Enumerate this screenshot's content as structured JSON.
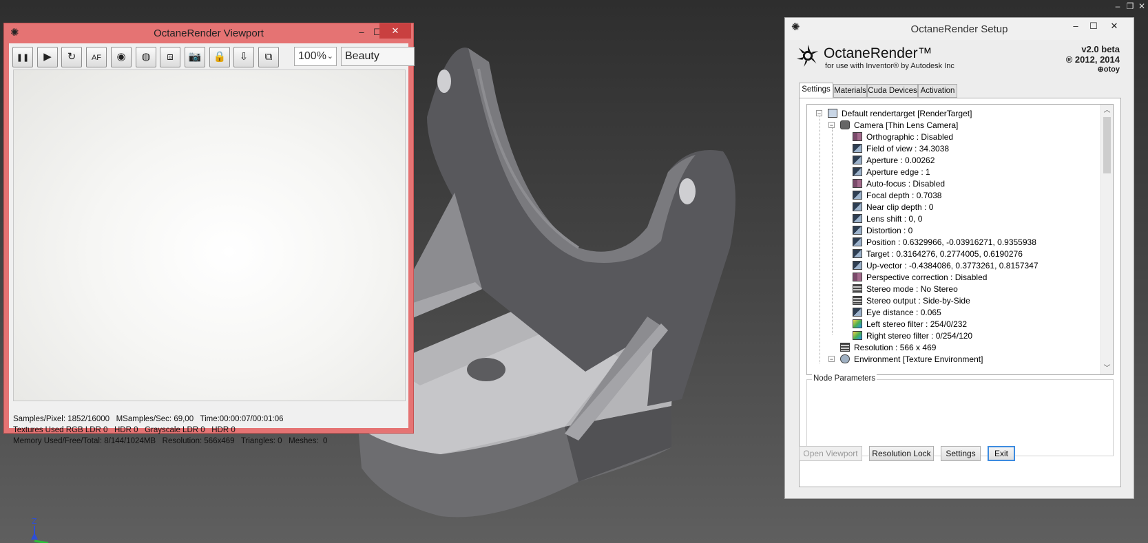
{
  "host": {
    "window_controls": [
      "–",
      "❐",
      "✕"
    ]
  },
  "viewport": {
    "title": "OctaneRender Viewport",
    "controls": {
      "min": "–",
      "max": "☐",
      "close": "✕"
    },
    "tools": [
      {
        "name": "pause-icon",
        "glyph": "❚❚"
      },
      {
        "name": "play-icon",
        "glyph": "▶"
      },
      {
        "name": "restart-icon",
        "glyph": "↻"
      },
      {
        "name": "focus-picker-icon",
        "glyph": "AF"
      },
      {
        "name": "white-balance-picker-icon",
        "glyph": "◉"
      },
      {
        "name": "material-picker-icon",
        "glyph": "◍"
      },
      {
        "name": "region-render-icon",
        "glyph": "⧈"
      },
      {
        "name": "save-image-icon",
        "glyph": "📷"
      },
      {
        "name": "lock-icon",
        "glyph": "🔒"
      },
      {
        "name": "export-icon",
        "glyph": "⇩"
      },
      {
        "name": "layers-icon",
        "glyph": "⧉"
      }
    ],
    "zoom": "100%",
    "render_pass": "Beauty",
    "stats": {
      "line1": "Samples/Pixel: 1852/16000   MSamples/Sec: 69,00   Time:00:00:07/00:01:06",
      "line2": "Textures Used RGB LDR 0   HDR 0   Grayscale LDR 0   HDR 0",
      "line3": "Memory Used/Free/Total: 8/144/1024MB   Resolution: 566x469   Triangles: 0   Meshes:  0"
    }
  },
  "setup": {
    "title": "OctaneRender Setup",
    "controls": {
      "min": "–",
      "max": "☐",
      "close": "✕"
    },
    "brand": "OctaneRender™",
    "brand_sub": "for use with Inventor® by Autodesk Inc",
    "version": "v2.0 beta",
    "copyright": "® 2012, 2014",
    "otoy": "otoy",
    "tabs": [
      "Settings",
      "Materials",
      "Cuda Devices",
      "Activation"
    ],
    "tree": [
      {
        "label": "Default rendertarget  [RenderTarget]",
        "level": 0,
        "icon": "rendertarget-icon",
        "expander": "−"
      },
      {
        "label": "Camera  [Thin Lens Camera]",
        "level": 1,
        "icon": "camera-icon",
        "expander": "−"
      },
      {
        "label": "Orthographic : Disabled",
        "level": 2,
        "icon": "bool-icon"
      },
      {
        "label": "Field of view : 34.3038",
        "level": 2,
        "icon": "float-icon"
      },
      {
        "label": "Aperture : 0.00262",
        "level": 2,
        "icon": "float-icon"
      },
      {
        "label": "Aperture edge : 1",
        "level": 2,
        "icon": "float-icon"
      },
      {
        "label": "Auto-focus : Disabled",
        "level": 2,
        "icon": "bool-icon"
      },
      {
        "label": "Focal depth : 0.7038",
        "level": 2,
        "icon": "float-icon"
      },
      {
        "label": "Near clip depth : 0",
        "level": 2,
        "icon": "float-icon"
      },
      {
        "label": "Lens shift : 0, 0",
        "level": 2,
        "icon": "float-icon"
      },
      {
        "label": "Distortion : 0",
        "level": 2,
        "icon": "float-icon"
      },
      {
        "label": "Position : 0.6329966, -0.03916271, 0.9355938",
        "level": 2,
        "icon": "float-icon"
      },
      {
        "label": "Target : 0.3164276, 0.2774005, 0.6190276",
        "level": 2,
        "icon": "float-icon"
      },
      {
        "label": "Up-vector : -0.4384086, 0.3773261, 0.8157347",
        "level": 2,
        "icon": "float-icon"
      },
      {
        "label": "Perspective correction : Disabled",
        "level": 2,
        "icon": "bool-icon"
      },
      {
        "label": "Stereo mode : No Stereo",
        "level": 2,
        "icon": "enum-icon"
      },
      {
        "label": "Stereo output : Side-by-Side",
        "level": 2,
        "icon": "enum-icon"
      },
      {
        "label": "Eye distance : 0.065",
        "level": 2,
        "icon": "float-icon"
      },
      {
        "label": "Left stereo filter : 254/0/232",
        "level": 2,
        "icon": "color-icon"
      },
      {
        "label": "Right stereo filter : 0/254/120",
        "level": 2,
        "icon": "color-icon"
      },
      {
        "label": "Resolution : 566 x 469",
        "level": 1,
        "icon": "enum-icon"
      },
      {
        "label": "Environment  [Texture Environment]",
        "level": 1,
        "icon": "environment-icon",
        "expander": "−"
      }
    ],
    "node_params_label": "Node Parameters",
    "buttons": {
      "open_viewport": "Open Viewport",
      "resolution_lock": "Resolution Lock",
      "settings": "Settings",
      "exit": "Exit"
    }
  },
  "axis": {
    "z_label": "Z"
  },
  "colors": {
    "viewport_frame": "#e57373",
    "setup_frame": "#ededed",
    "focus": "#3c8be0"
  }
}
